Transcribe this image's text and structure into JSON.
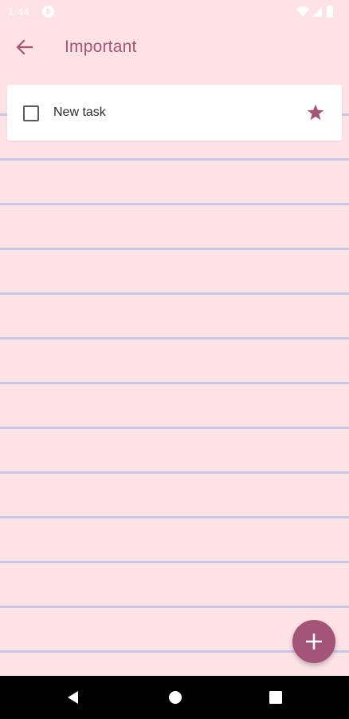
{
  "status_bar": {
    "time": "1:44",
    "icons": [
      "app-notification-icon",
      "wifi-icon",
      "signal-icon",
      "battery-icon"
    ]
  },
  "app_bar": {
    "back_icon": "arrow-left-icon",
    "title": "Important"
  },
  "tasks": [
    {
      "title": "New task",
      "completed": false,
      "starred": true
    }
  ],
  "fab": {
    "icon": "plus-icon"
  },
  "nav_bar": {
    "icons": [
      "nav-back-icon",
      "nav-home-icon",
      "nav-recents-icon"
    ]
  },
  "colors": {
    "background": "#fde2e6",
    "accent": "#a45577",
    "rule_line": "#c9c6e6",
    "card": "#ffffff",
    "nav_bar": "#000000"
  }
}
